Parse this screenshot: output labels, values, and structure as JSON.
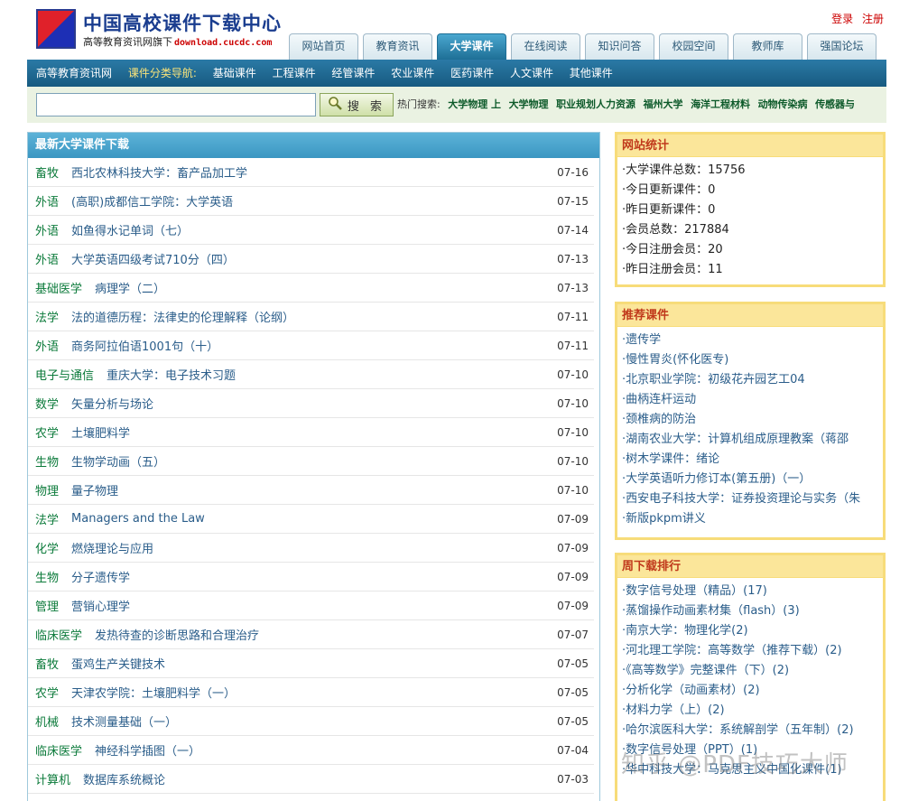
{
  "header": {
    "title": "中国高校课件下载中心",
    "tagline": "高等教育资讯网旗下",
    "url": "download.cucdc.com",
    "login": "登录",
    "register": "注册",
    "tabs": [
      "网站首页",
      "教育资讯",
      "大学课件",
      "在线阅读",
      "知识问答",
      "校园空间",
      "教师库",
      "强国论坛"
    ],
    "active_tab": "大学课件",
    "logo_colors": {
      "red": "#e0212a",
      "blue": "#1d2fb5"
    }
  },
  "category_bar": {
    "home": "高等教育资讯网",
    "nav_label": "课件分类导航:",
    "items": [
      "基础课件",
      "工程课件",
      "经管课件",
      "农业课件",
      "医药课件",
      "人文课件",
      "其他课件"
    ]
  },
  "search": {
    "input_value": "",
    "button_label": "搜 索",
    "hot_label": "热门搜索:",
    "hot_items": [
      "大学物理 上",
      "大学物理",
      "职业规划人力资源",
      "福州大学",
      "海洋工程材料",
      "动物传染病",
      "传感器与"
    ]
  },
  "main": {
    "title": "最新大学课件下载",
    "rows": [
      {
        "cat": "畜牧",
        "title": "西北农林科技大学：畜产品加工学",
        "date": "07-16"
      },
      {
        "cat": "外语",
        "title": "(高职)成都信工学院：大学英语",
        "date": "07-15"
      },
      {
        "cat": "外语",
        "title": "如鱼得水记单词（七）",
        "date": "07-14"
      },
      {
        "cat": "外语",
        "title": "大学英语四级考试710分（四）",
        "date": "07-13"
      },
      {
        "cat": "基础医学",
        "title": "病理学（二）",
        "date": "07-13"
      },
      {
        "cat": "法学",
        "title": "法的道德历程：法律史的伦理解释（论纲）",
        "date": "07-11"
      },
      {
        "cat": "外语",
        "title": "商务阿拉伯语1001句（十）",
        "date": "07-11"
      },
      {
        "cat": "电子与通信",
        "title": "重庆大学：电子技术习题",
        "date": "07-10"
      },
      {
        "cat": "数学",
        "title": "矢量分析与场论",
        "date": "07-10"
      },
      {
        "cat": "农学",
        "title": "土壤肥料学",
        "date": "07-10"
      },
      {
        "cat": "生物",
        "title": "生物学动画（五）",
        "date": "07-10"
      },
      {
        "cat": "物理",
        "title": "量子物理",
        "date": "07-10"
      },
      {
        "cat": "法学",
        "title": "Managers and the Law",
        "date": "07-09"
      },
      {
        "cat": "化学",
        "title": "燃烧理论与应用",
        "date": "07-09"
      },
      {
        "cat": "生物",
        "title": "分子遗传学",
        "date": "07-09"
      },
      {
        "cat": "管理",
        "title": "营销心理学",
        "date": "07-09"
      },
      {
        "cat": "临床医学",
        "title": "发热待查的诊断思路和合理治疗",
        "date": "07-07"
      },
      {
        "cat": "畜牧",
        "title": "蛋鸡生产关键技术",
        "date": "07-05"
      },
      {
        "cat": "农学",
        "title": "天津农学院：土壤肥料学（一）",
        "date": "07-05"
      },
      {
        "cat": "机械",
        "title": "技术测量基础（一）",
        "date": "07-05"
      },
      {
        "cat": "临床医学",
        "title": "神经科学插图（一）",
        "date": "07-04"
      },
      {
        "cat": "计算机",
        "title": "数据库系统概论",
        "date": "07-03"
      }
    ]
  },
  "stats": {
    "title": "网站统计",
    "items": [
      "·大学课件总数：15756",
      "·今日更新课件：0",
      "·昨日更新课件：0",
      "·会员总数：217884",
      "·今日注册会员：20",
      "·昨日注册会员：11"
    ]
  },
  "recommended": {
    "title": "推荐课件",
    "items": [
      "·遗传学",
      "·慢性胃炎(怀化医专)",
      "·北京职业学院：初级花卉园艺工04",
      "·曲柄连杆运动",
      "·颈椎病的防治",
      "·湖南农业大学：计算机组成原理教案（蒋邵",
      "·树木学课件：绪论",
      "·大学英语听力修订本(第五册)（一）",
      "·西安电子科技大学：证券投资理论与实务（朱",
      "·新版pkpm讲义"
    ]
  },
  "weekly_rank": {
    "title": "周下载排行",
    "items": [
      "·数字信号处理（精品）(17)",
      "·蒸馏操作动画素材集（flash）(3)",
      "·南京大学：物理化学(2)",
      "·河北理工学院：高等数学（推荐下载）(2)",
      "·《高等数学》完整课件（下）(2)",
      "·分析化学（动画素材）(2)",
      "·材料力学（上）(2)",
      "·哈尔滨医科大学：系统解剖学（五年制）(2)",
      "·数字信号处理（PPT）(1)",
      "·华中科技大学：马克思主义中国化课件(1)"
    ]
  },
  "watermark": "知乎 @PDF技巧大师"
}
